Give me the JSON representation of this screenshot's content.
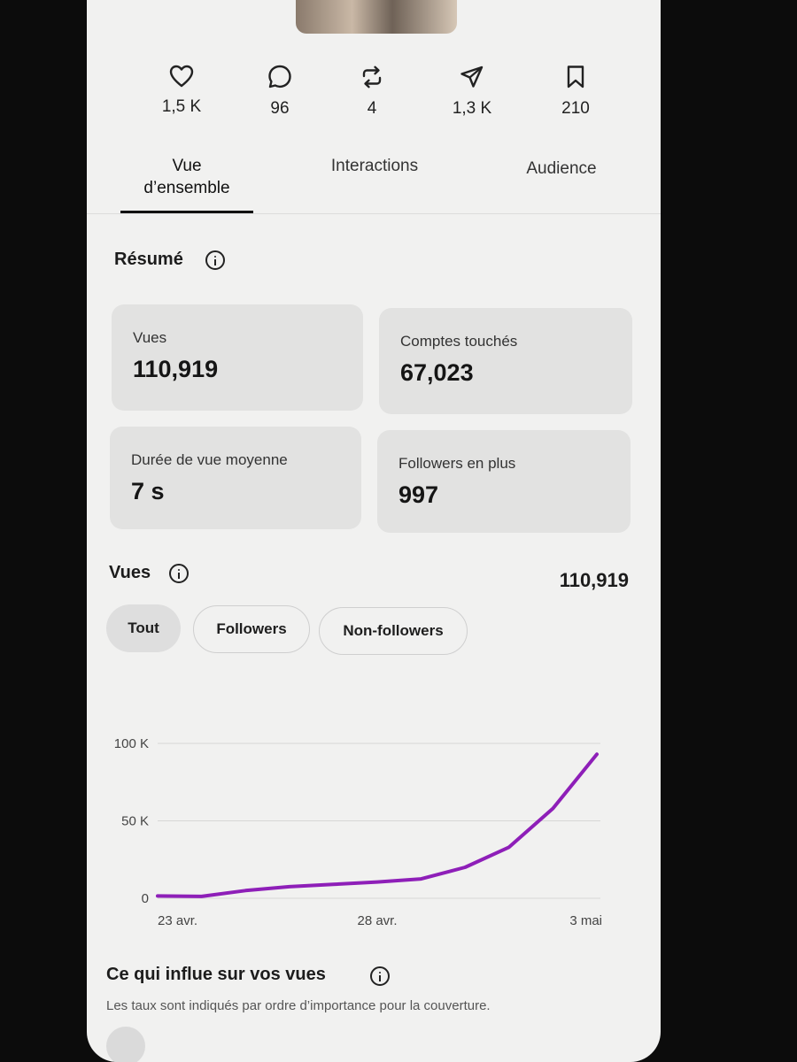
{
  "stats": [
    {
      "icon": "heart-icon",
      "value": "1,5 K"
    },
    {
      "icon": "comment-icon",
      "value": "96"
    },
    {
      "icon": "repost-icon",
      "value": "4"
    },
    {
      "icon": "share-icon",
      "value": "1,3 K"
    },
    {
      "icon": "bookmark-icon",
      "value": "210"
    }
  ],
  "tabs": [
    {
      "line1": "Vue",
      "line2": "d’ensemble",
      "active": true
    },
    {
      "line1": "Interactions",
      "line2": "",
      "active": false
    },
    {
      "line1": "Audience",
      "line2": "",
      "active": false
    }
  ],
  "summary": {
    "title": "Résumé",
    "cards": [
      {
        "label": "Vues",
        "value": "110,919"
      },
      {
        "label": "Comptes touchés",
        "value": "67,023"
      },
      {
        "label": "Durée de vue moyenne",
        "value": "7 s"
      },
      {
        "label": "Followers en plus",
        "value": "997"
      }
    ]
  },
  "views": {
    "title": "Vues",
    "total": "110,919",
    "filters": [
      "Tout",
      "Followers",
      "Non-followers"
    ],
    "active_filter": "Tout"
  },
  "chart_data": {
    "type": "line",
    "x": [
      "23 avr.",
      "24 avr.",
      "25 avr.",
      "26 avr.",
      "27 avr.",
      "28 avr.",
      "29 avr.",
      "30 avr.",
      "1 mai",
      "2 mai",
      "3 mai"
    ],
    "series": [
      {
        "values": [
          1500,
          1200,
          5000,
          7500,
          9000,
          10500,
          12500,
          20000,
          33000,
          58000,
          93000
        ]
      }
    ],
    "ytick_labels": [
      "0",
      "50 K",
      "100 K"
    ],
    "yticks": [
      0,
      50000,
      100000
    ],
    "xtick_labels": [
      "23 avr.",
      "28 avr.",
      "3 mai"
    ],
    "ylim": [
      0,
      100000
    ],
    "color": "#8e1fb8",
    "grid": true
  },
  "influence": {
    "title": "Ce qui influe sur vos vues",
    "subtitle": "Les taux sont indiqués par ordre d’importance pour la couverture."
  }
}
